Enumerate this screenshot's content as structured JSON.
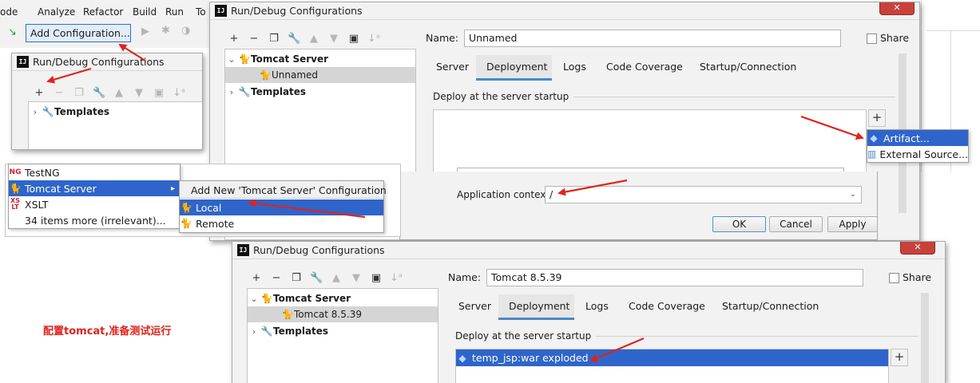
{
  "ide": {
    "menu_fragments": [
      "ode",
      "Analyze",
      "Refactor",
      "Build",
      "Run",
      "To"
    ],
    "add_configuration_label": "Add Configuration..."
  },
  "small_dialog": {
    "title": "Run/Debug Configurations",
    "tree_items": [
      "Templates"
    ]
  },
  "main_dialog": {
    "title": "Run/Debug Configurations",
    "name_label": "Name:",
    "name_value": "Unnamed",
    "share_label": "Share",
    "tree": {
      "group": "Tomcat Server",
      "child": "Unnamed",
      "templates": "Templates"
    },
    "tabs": [
      "Server",
      "Deployment",
      "Logs",
      "Code Coverage",
      "Startup/Connection"
    ],
    "active_tab": "Deployment",
    "deploy_section_title": "Deploy at the server startup",
    "add_menu": [
      "Artifact...",
      "External Source..."
    ],
    "app_context_label": "Application context:",
    "app_context_value": "/",
    "buttons": {
      "ok": "OK",
      "cancel": "Cancel",
      "apply": "Apply"
    }
  },
  "add_new_menu": {
    "items": [
      "TestNG",
      "Tomcat Server",
      "XSLT",
      "34 items more (irrelevant)..."
    ],
    "submenu_title": "Add New 'Tomcat Server' Configuration",
    "submenu_items": [
      "Local",
      "Remote"
    ]
  },
  "final_dialog": {
    "title": "Run/Debug Configurations",
    "name_label": "Name:",
    "name_value": "Tomcat 8.5.39",
    "share_label": "Share",
    "tree": {
      "group": "Tomcat Server",
      "child": "Tomcat 8.5.39",
      "templates": "Templates"
    },
    "tabs": [
      "Server",
      "Deployment",
      "Logs",
      "Code Coverage",
      "Startup/Connection"
    ],
    "deploy_section_title": "Deploy at the server startup",
    "artifact": "temp_jsp:war exploded"
  },
  "caption": "配置tomcat,准备测试运行",
  "colors": {
    "arrow": "#e0231c",
    "selection": "#2f65ca",
    "tab_underline": "#4a88c7",
    "close_button": "#c8423b"
  }
}
